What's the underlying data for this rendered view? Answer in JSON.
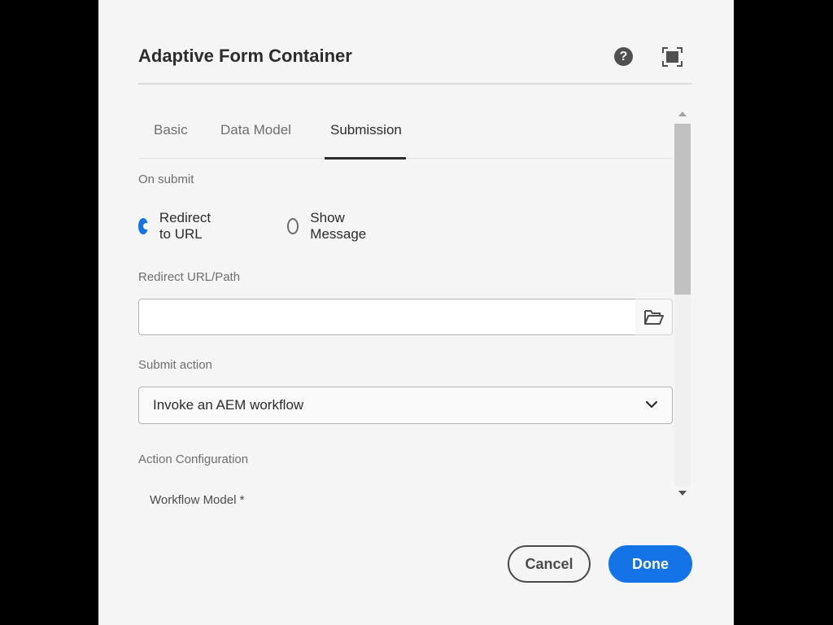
{
  "dialog": {
    "title": "Adaptive Form Container"
  },
  "header": {
    "help_icon": "question-circle-icon",
    "help_glyph": "?",
    "fullscreen_icon": "fullscreen-icon"
  },
  "tabs": [
    {
      "label": "Basic",
      "active": false
    },
    {
      "label": "Data Model",
      "active": false
    },
    {
      "label": "Submission",
      "active": true
    }
  ],
  "form": {
    "on_submit_label": "On submit",
    "radios": [
      {
        "label": "Redirect to URL",
        "checked": true
      },
      {
        "label": "Show Message",
        "checked": false
      }
    ],
    "redirect_url_label": "Redirect URL/Path",
    "redirect_url_value": "",
    "browse_icon": "folder-open-icon",
    "submit_action_label": "Submit action",
    "submit_action_value": "Invoke an AEM workflow",
    "action_configuration_label": "Action Configuration",
    "workflow_model_label": "Workflow Model *"
  },
  "footer": {
    "cancel_label": "Cancel",
    "done_label": "Done"
  },
  "colors": {
    "accent": "#1473e6",
    "dialog_background": "#f5f5f5",
    "outer_background": "#000000"
  }
}
